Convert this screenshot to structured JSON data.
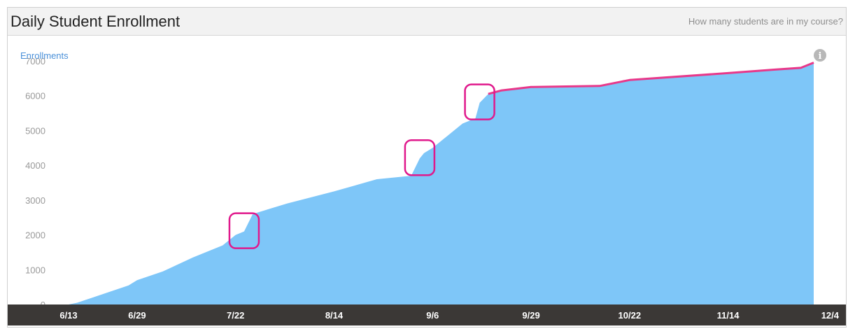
{
  "header": {
    "title": "Daily Student Enrollment",
    "help_link": "How many students are in my course?"
  },
  "info_icon": "info-circle-icon",
  "colors": {
    "area": "#7ec6f8",
    "highlight_line": "#e8388a",
    "highlight_box": "#e0198c",
    "axis_bar": "#3b3836",
    "axis_label": "#ffffff",
    "series_label": "#4a90d9",
    "tick_label": "#999999"
  },
  "chart_data": {
    "type": "area",
    "title": "",
    "ylabel": "Enrollments",
    "xlabel": "",
    "ylim": [
      0,
      7000
    ],
    "yticks": [
      0,
      1000,
      2000,
      3000,
      4000,
      5000,
      6000,
      7000
    ],
    "xticks": [
      "6/13",
      "6/29",
      "7/22",
      "8/14",
      "9/6",
      "9/29",
      "10/22",
      "11/14",
      "12/4"
    ],
    "x": [
      "6/13",
      "6/15",
      "6/21",
      "6/27",
      "6/29",
      "7/5",
      "7/12",
      "7/19",
      "7/22",
      "7/24",
      "7/26",
      "8/3",
      "8/14",
      "8/24",
      "9/1",
      "9/3",
      "9/4",
      "9/6",
      "9/13",
      "9/16",
      "9/17",
      "9/19",
      "9/22",
      "9/29",
      "10/15",
      "10/22",
      "11/14",
      "11/25",
      "12/1",
      "12/4"
    ],
    "values": [
      0,
      50,
      300,
      550,
      700,
      950,
      1350,
      1700,
      2000,
      2100,
      2600,
      2900,
      3250,
      3600,
      3700,
      4200,
      4350,
      4500,
      5200,
      5350,
      5800,
      6050,
      6150,
      6250,
      6280,
      6450,
      6650,
      6750,
      6800,
      6950
    ],
    "grid": false,
    "highlighted_segment": {
      "from": "9/19",
      "to": "12/4"
    },
    "annotations": [
      {
        "type": "box",
        "at": "7/24"
      },
      {
        "type": "box",
        "at": "9/3"
      },
      {
        "type": "box",
        "at": "9/17"
      }
    ]
  }
}
